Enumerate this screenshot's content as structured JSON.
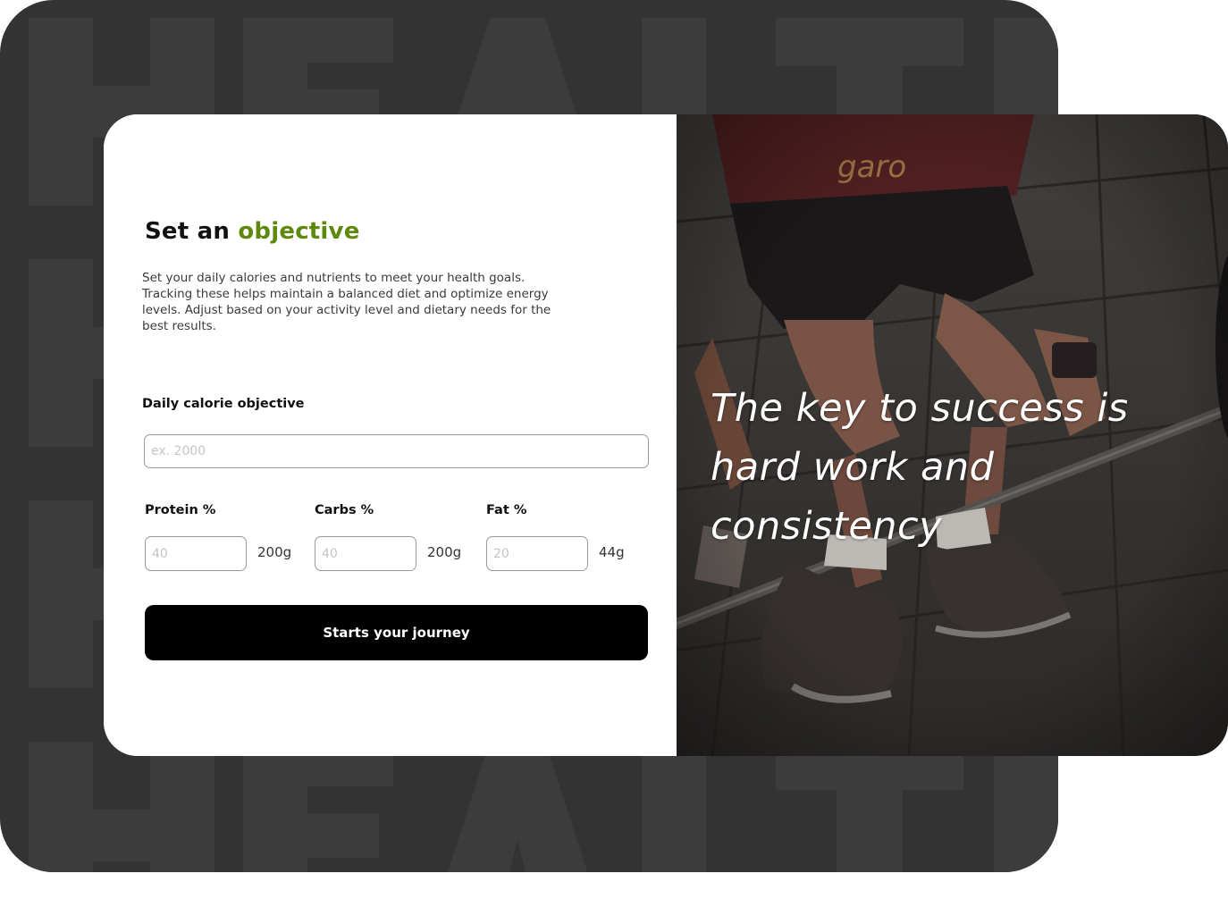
{
  "background": {
    "watermark_text": "HEALTH",
    "color": "#333333",
    "watermark_color": "#3c3c3c"
  },
  "form": {
    "title_prefix": "Set an",
    "title_accent": "objective",
    "accent_color": "#5e8a0c",
    "description": "Set your daily calories and nutrients to meet your health goals. Tracking these helps maintain a balanced diet and optimize energy levels. Adjust based on your activity level and dietary needs for the best results.",
    "calorie": {
      "label": "Daily calorie objective",
      "placeholder": "ex. 2000"
    },
    "macros": [
      {
        "label": "Protein %",
        "placeholder": "40",
        "unit": "200g"
      },
      {
        "label": "Carbs %",
        "placeholder": "40",
        "unit": "200g"
      },
      {
        "label": "Fat %",
        "placeholder": "20",
        "unit": "44g"
      }
    ],
    "submit_label": "Starts your journey"
  },
  "hero": {
    "quote": "The key to success is hard work and consistency"
  }
}
